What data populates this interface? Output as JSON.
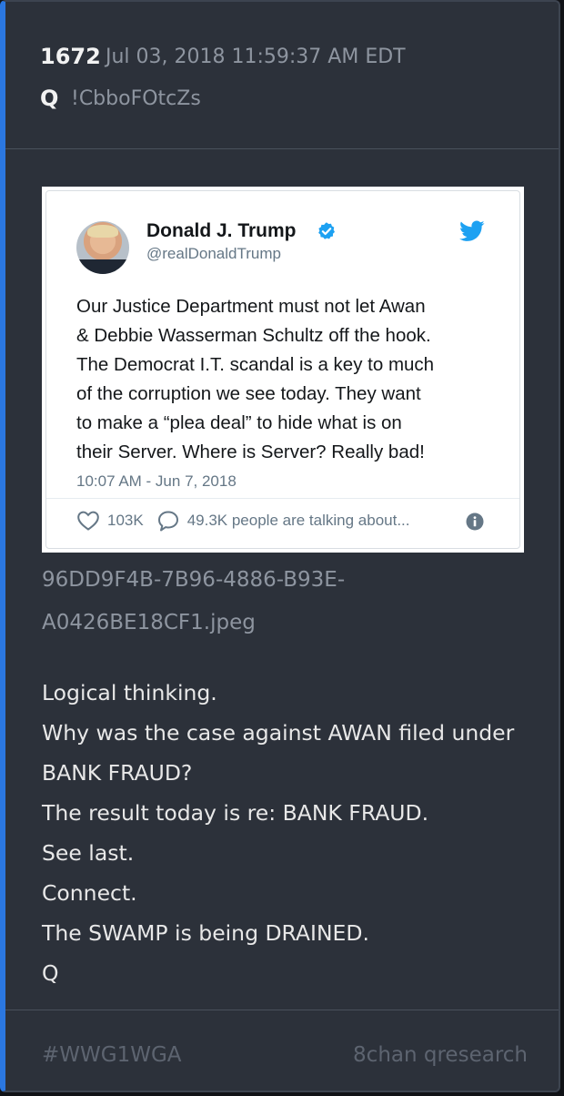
{
  "header": {
    "post_number": "1672",
    "date": "Jul 03, 2018 11:59:37 AM EDT",
    "author": "Q",
    "tripcode": "!CbboFOtcZs"
  },
  "tweet": {
    "name": "Donald J. Trump",
    "handle": "@realDonaldTrump",
    "body_lines": [
      "Our Justice Department must not let Awan",
      "& Debbie Wasserman Schultz off the hook.",
      "The Democrat I.T. scandal is a key to much",
      "of the corruption we see today. They want",
      "to make a “plea deal” to hide what is on",
      "their Server. Where is Server? Really bad!"
    ],
    "timestamp": "10:07 AM - Jun 7, 2018",
    "likes": "103K",
    "replies_text": "49.3K people are talking about...",
    "colors": {
      "twitter_blue": "#1da1f2",
      "text": "#14171a",
      "muted": "#657786"
    }
  },
  "attachment": {
    "filename_lines": [
      "96DD9F4B-7B96-4886-B93E-",
      "A0426BE18CF1.jpeg"
    ]
  },
  "post_body": {
    "lines": [
      "Logical thinking.",
      "Why was the case against AWAN filed under",
      "BANK FRAUD?",
      "The result today is re: BANK FRAUD.",
      "See last.",
      "Connect.",
      "The SWAMP is being DRAINED.",
      "Q"
    ]
  },
  "footer": {
    "hashtag": "#WWG1WGA",
    "source": "8chan qresearch"
  },
  "colors": {
    "accent": "#2b77e0",
    "card_background": "#2c313a",
    "muted_text": "#8e95a0"
  }
}
